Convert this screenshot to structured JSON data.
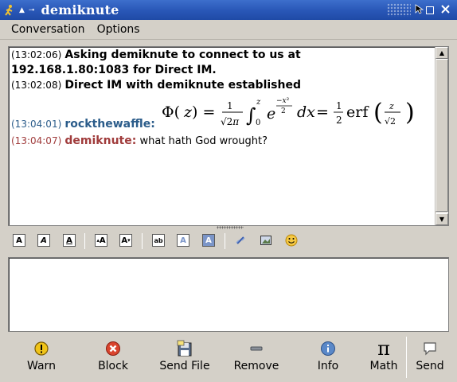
{
  "window": {
    "title": "demiknute"
  },
  "menu": {
    "items": [
      "Conversation",
      "Options"
    ]
  },
  "conversation": {
    "messages": [
      {
        "time": "(13:02:06)",
        "text": "Asking demiknute to connect to us at 192.168.1.80:1083 for Direct IM."
      },
      {
        "time": "(13:02:08)",
        "text": "Direct IM with demiknute established"
      },
      {
        "time": "(13:04:01)",
        "sender": "rockthewaffle:",
        "text": ""
      },
      {
        "time": "(13:04:07)",
        "sender": "demiknute:",
        "text": "what hath God wrought?"
      }
    ]
  },
  "toolbar": {
    "buttons": [
      "bold",
      "italic",
      "underline",
      "larger-text",
      "smaller-text",
      "font-face",
      "foreground-color",
      "background-color",
      "insert-link",
      "insert-image",
      "insert-smiley"
    ]
  },
  "actions": {
    "warn": "Warn",
    "block": "Block",
    "send_file": "Send File",
    "remove": "Remove",
    "info": "Info",
    "math": "Math",
    "send": "Send"
  },
  "colors": {
    "titlebar": "#2a58b8",
    "self_name": "#2b5c8a",
    "buddy_name": "#a03c3c",
    "warn_yellow": "#f0c419",
    "block_red": "#d9442e",
    "info_blue": "#5a88c8"
  }
}
